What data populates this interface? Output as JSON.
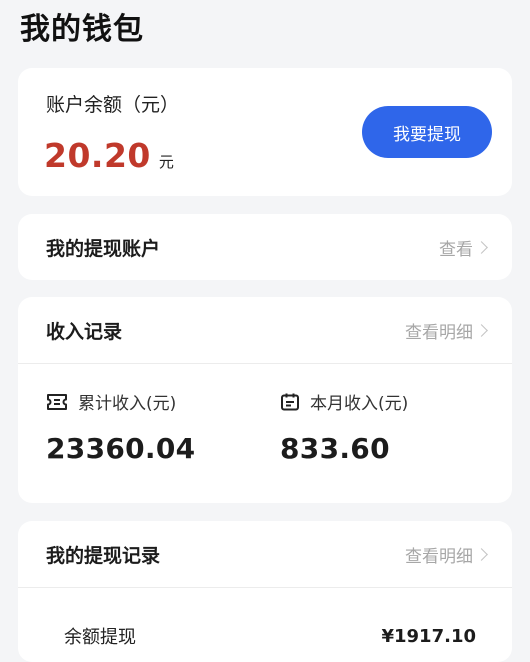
{
  "header": {
    "title": "我的钱包"
  },
  "balance": {
    "label": "账户余额（元）",
    "amount": "20.20",
    "unit": "元",
    "withdraw_label": "我要提现"
  },
  "withdraw_account": {
    "title": "我的提现账户",
    "link": "查看"
  },
  "income_records": {
    "title": "收入记录",
    "link": "查看明细",
    "total_label": "累计收入(元)",
    "total_value": "23360.04",
    "month_label": "本月收入(元)",
    "month_value": "833.60"
  },
  "withdraw_records": {
    "title": "我的提现记录",
    "link": "查看明细",
    "items": [
      {
        "type": "余额提现",
        "amount": "¥1917.10"
      }
    ]
  },
  "colors": {
    "accent": "#2f66ea",
    "amount_red": "#c0392b"
  }
}
